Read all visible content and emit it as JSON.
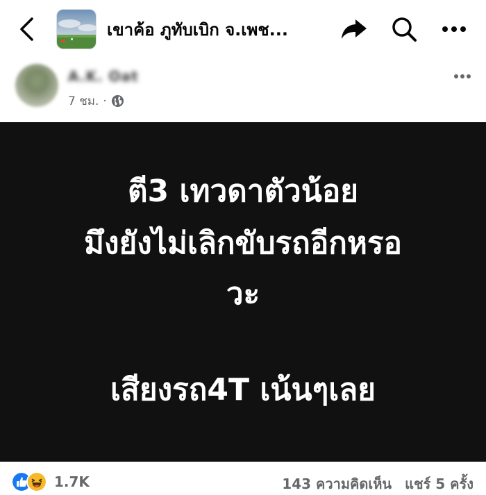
{
  "topbar": {
    "group_name": "เขาค้อ ภูทับเบิก จ.เพช...",
    "icons": [
      "back-icon",
      "share-icon",
      "search-icon",
      "more-icon"
    ]
  },
  "post": {
    "author_name": "A.K. Oat",
    "time": "7 ชม.",
    "meta_separator": "·",
    "privacy_icon": "globe-icon",
    "lines": [
      "ตี3 เทวดาตัวน้อย",
      "มึงยังไม่เลิกขับรถอีกหรอ",
      "วะ",
      "เสียงรถ4T เน้นๆเลย"
    ],
    "background_color": "#111111",
    "text_color": "#ffffff"
  },
  "footer": {
    "reaction_icons": [
      "like-icon",
      "haha-icon"
    ],
    "reaction_count": "1.7K",
    "comments": "143 ความคิดเห็น",
    "shares": "แชร์ 5 ครั้ง"
  },
  "colors": {
    "like_blue": "#1877f2",
    "haha_yellow": "#f7b928",
    "secondary_text": "#65676b"
  }
}
